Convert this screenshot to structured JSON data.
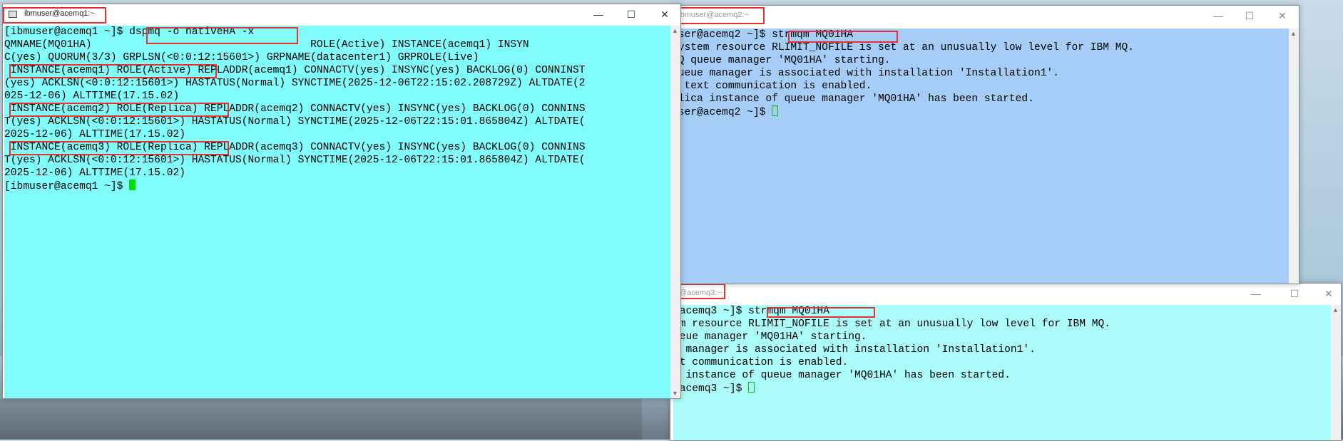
{
  "colors": {
    "term1_bg": "#80fdfc",
    "term2_bg": "#a5cdf8",
    "term3_bg": "#acfcfb",
    "highlight": "#e8302e",
    "cursor": "#00e000"
  },
  "window1": {
    "title": "ibmuser@acemq1:~",
    "controls": {
      "minimize": "—",
      "maximize": "☐",
      "close": "✕"
    },
    "lines": [
      "[ibmuser@acemq1 ~]$ dspmq -o nativeHA -x",
      "QMNAME(MQ01HA)                                   ROLE(Active) INSTANCE(acemq1) INSYN",
      "C(yes) QUORUM(3/3) GRPLSN(<0:0:12:15601>) GRPNAME(datacenter1) GRPROLE(Live)",
      " INSTANCE(acemq1) ROLE(Active) REPLADDR(acemq1) CONNACTV(yes) INSYNC(yes) BACKLOG(0) CONNINST",
      "(yes) ACKLSN(<0:0:12:15601>) HASTATUS(Normal) SYNCTIME(2025-12-06T22:15:02.208729Z) ALTDATE(2",
      "025-12-06) ALTTIME(17.15.02)",
      " INSTANCE(acemq2) ROLE(Replica) REPLADDR(acemq2) CONNACTV(yes) INSYNC(yes) BACKLOG(0) CONNINS",
      "T(yes) ACKLSN(<0:0:12:15601>) HASTATUS(Normal) SYNCTIME(2025-12-06T22:15:01.865804Z) ALTDATE(",
      "2025-12-06) ALTTIME(17.15.02)",
      " INSTANCE(acemq3) ROLE(Replica) REPLADDR(acemq3) CONNACTV(yes) INSYNC(yes) BACKLOG(0) CONNINS",
      "T(yes) ACKLSN(<0:0:12:15601>) HASTATUS(Normal) SYNCTIME(2025-12-06T22:15:01.865804Z) ALTDATE(",
      "2025-12-06) ALTTIME(17.15.02)",
      "[ibmuser@acemq1 ~]$ "
    ]
  },
  "window2": {
    "title": "ibmuser@acemq2:~",
    "controls": {
      "minimize": "—",
      "maximize": "☐",
      "close": "✕"
    },
    "lines": [
      "user@acemq2 ~]$ strmqm MQ01HA",
      "system resource RLIMIT_NOFILE is set at an unusually low level for IBM MQ.",
      "MQ queue manager 'MQ01HA' starting.",
      "queue manager is associated with installation 'Installation1'.",
      "n text communication is enabled.",
      "plica instance of queue manager 'MQ01HA' has been started.",
      "user@acemq2 ~]$ "
    ]
  },
  "window3": {
    "title": "@acemq3:~",
    "controls": {
      "minimize": "—",
      "maximize": "☐",
      "close": "✕"
    },
    "lines": [
      "@acemq3 ~]$ strmqm MQ01HA",
      "em resource RLIMIT_NOFILE is set at an unusually low level for IBM MQ.",
      "ueue manager 'MQ01HA' starting.",
      "e manager is associated with installation 'Installation1'.",
      "xt communication is enabled.",
      "a instance of queue manager 'MQ01HA' has been started.",
      "@acemq3 ~]$ "
    ]
  }
}
